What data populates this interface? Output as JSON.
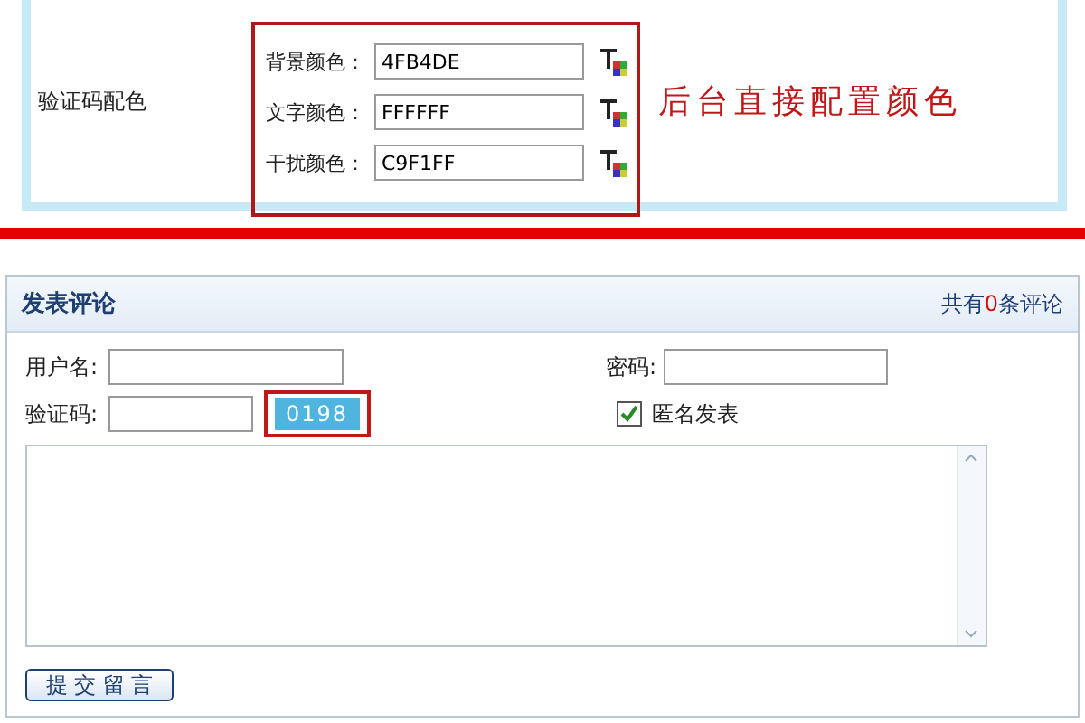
{
  "config": {
    "label": "验证码配色",
    "rows": [
      {
        "label": "背景颜色：",
        "value": "4FB4DE"
      },
      {
        "label": "文字颜色：",
        "value": "FFFFFF"
      },
      {
        "label": "干扰颜色：",
        "value": "C9F1FF"
      }
    ],
    "annotation": "后台直接配置颜色"
  },
  "comment": {
    "title": "发表评论",
    "count": "共有**0**条评论",
    "username_label": "用户名:",
    "password_label": "密码:",
    "captcha_label": "验证码:",
    "captcha_code": "0198",
    "captcha_highlighted": true,
    "anonymous": {
      "label": "匿名发表",
      "checked": true
    },
    "submit": "提 交 留 言"
  }
}
